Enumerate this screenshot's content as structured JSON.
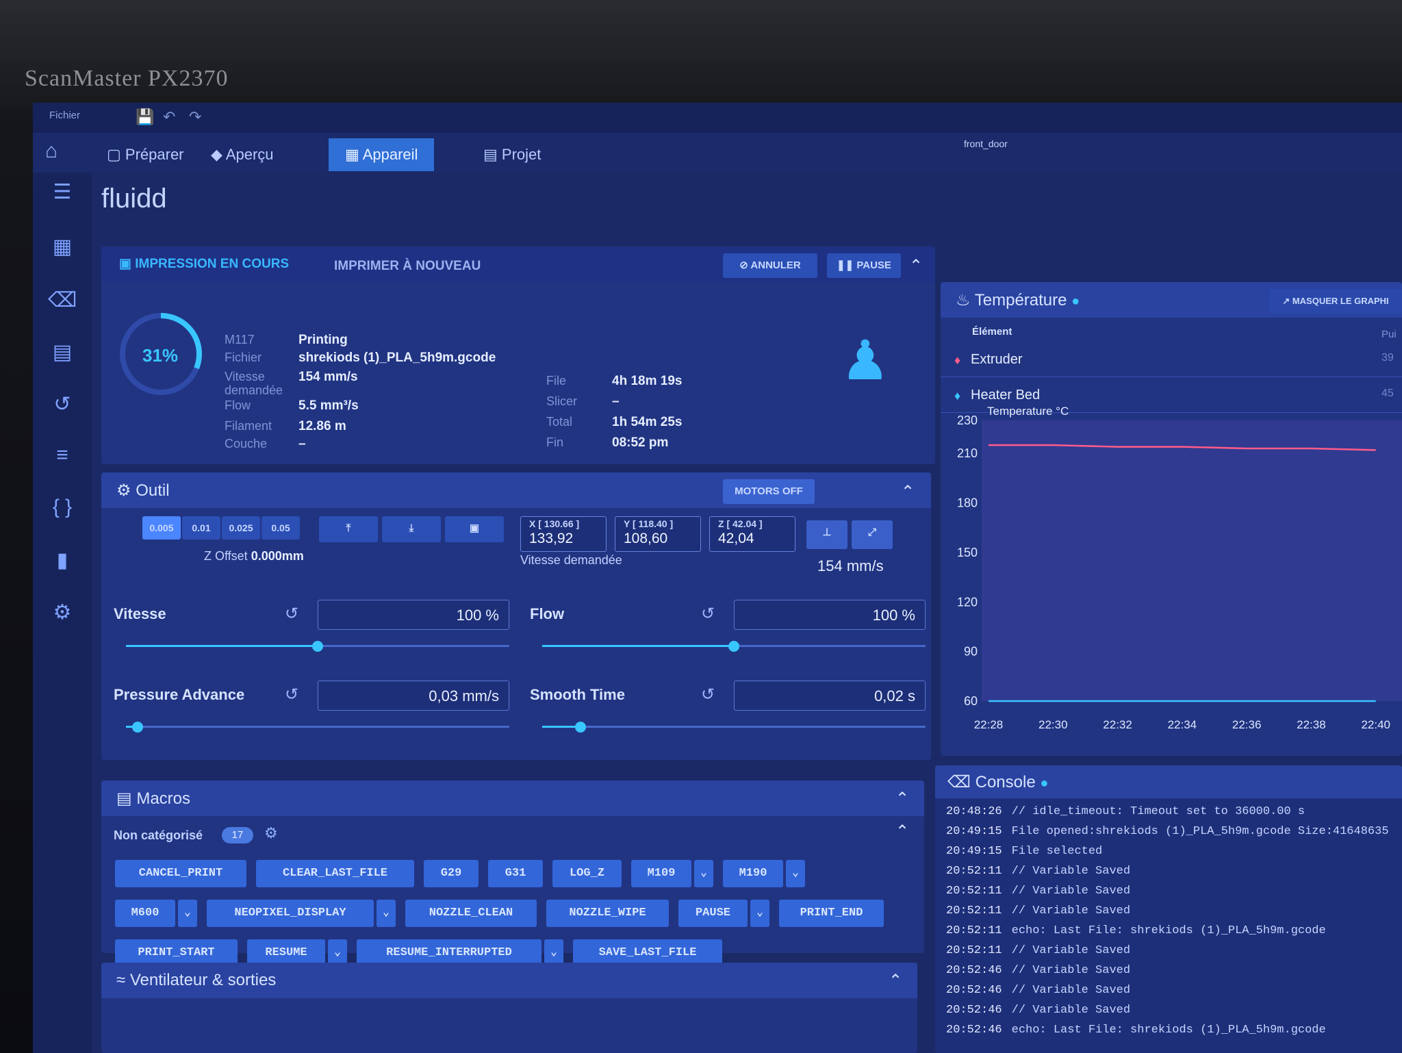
{
  "monitor": {
    "label": "ScanMaster PX2370"
  },
  "app": {
    "brand": "fluidd",
    "menu_label": "Fichier",
    "device_name": "front_door"
  },
  "nav": {
    "tabs": [
      {
        "label": "Préparer"
      },
      {
        "label": "Aperçu"
      },
      {
        "label": "Appareil"
      },
      {
        "label": "Projet"
      }
    ]
  },
  "job": {
    "tab_active": "IMPRESSION EN COURS",
    "tab_reprint": "IMPRIMER À NOUVEAU",
    "cancel_label": "ANNULER",
    "pause_label": "PAUSE",
    "progress_pct": 31,
    "progress_text": "31%",
    "fields": [
      {
        "label": "M117",
        "value": "Printing"
      },
      {
        "label": "Fichier",
        "value": "shrekiods (1)_PLA_5h9m.gcode"
      },
      {
        "label": "Vitesse demandée",
        "value": "154 mm/s"
      },
      {
        "label": "Flow",
        "value": "5.5 mm³/s"
      },
      {
        "label": "Filament",
        "value": "12.86 m"
      },
      {
        "label": "Couche",
        "value": "–"
      }
    ],
    "times": [
      {
        "label": "File",
        "value": "4h 18m 19s"
      },
      {
        "label": "Slicer",
        "value": "–"
      },
      {
        "label": "Total",
        "value": "1h 54m 25s"
      },
      {
        "label": "Fin",
        "value": "08:52 pm"
      }
    ]
  },
  "tool": {
    "title": "Outil",
    "motors_off": "MOTORS OFF",
    "steps": [
      "0.005",
      "0.01",
      "0.025",
      "0.05"
    ],
    "z_offset_label": "Z Offset",
    "z_offset_value": "0.000mm",
    "axes": [
      {
        "label": "X [ 130.66 ]",
        "value": "133,92"
      },
      {
        "label": "Y [ 118.40 ]",
        "value": "108,60"
      },
      {
        "label": "Z [ 42.04 ]",
        "value": "42,04"
      }
    ],
    "speed_caption": "Vitesse demandée",
    "speed_value": "154 mm/s",
    "controls": [
      {
        "label": "Vitesse",
        "value": "100 %",
        "pos": 0.5
      },
      {
        "label": "Flow",
        "value": "100 %",
        "pos": 0.5
      },
      {
        "label": "Pressure Advance",
        "value": "0,03 mm/s",
        "pos": 0.03
      },
      {
        "label": "Smooth Time",
        "value": "0,02 s",
        "pos": 0.1
      }
    ]
  },
  "macros": {
    "title": "Macros",
    "group": "Non catégorisé",
    "count": "17",
    "items": [
      "CANCEL_PRINT",
      "CLEAR_LAST_FILE",
      "G29",
      "G31",
      "LOG_Z",
      "M109",
      "M190",
      "M600",
      "NEOPIXEL_DISPLAY",
      "NOZZLE_CLEAN",
      "NOZZLE_WIPE",
      "PAUSE",
      "PRINT_END",
      "PRINT_START",
      "RESUME",
      "RESUME_INTERRUPTED",
      "SAVE_LAST_FILE"
    ]
  },
  "fans": {
    "title": "Ventilateur & sorties"
  },
  "temperature": {
    "title": "Température",
    "hide_graph": "MASQUER LE GRAPHI",
    "col_element": "Élément",
    "col_power": "Pui",
    "rows": [
      {
        "name": "Extruder",
        "power": "39",
        "color": "#ff5c8a"
      },
      {
        "name": "Heater Bed",
        "power": "45",
        "color": "#39c6ff"
      }
    ]
  },
  "chart_data": {
    "type": "line",
    "title": "Temperature °C",
    "yticks": [
      230,
      210,
      180,
      150,
      120,
      90,
      60
    ],
    "ylim": [
      60,
      230
    ],
    "xticks": [
      "22:28",
      "22:30",
      "22:32",
      "22:34",
      "22:36",
      "22:38",
      "22:40"
    ],
    "series": [
      {
        "name": "Extruder",
        "color": "#ff5c8a",
        "values": [
          215,
          215,
          214,
          214,
          213,
          213,
          212
        ]
      },
      {
        "name": "Heater Bed",
        "color": "#39c6ff",
        "values": [
          60,
          60,
          60,
          60,
          60,
          60,
          60
        ]
      }
    ]
  },
  "console": {
    "title": "Console",
    "lines": [
      {
        "time": "20:48:26",
        "text": "// idle_timeout: Timeout set to 36000.00 s"
      },
      {
        "time": "20:49:15",
        "text": "File opened:shrekiods (1)_PLA_5h9m.gcode Size:41648635"
      },
      {
        "time": "20:49:15",
        "text": "File selected"
      },
      {
        "time": "20:52:11",
        "text": "// Variable Saved"
      },
      {
        "time": "20:52:11",
        "text": "// Variable Saved"
      },
      {
        "time": "20:52:11",
        "text": "// Variable Saved"
      },
      {
        "time": "20:52:11",
        "text": "echo: Last File: shrekiods (1)_PLA_5h9m.gcode"
      },
      {
        "time": "20:52:11",
        "text": "// Variable Saved"
      },
      {
        "time": "20:52:46",
        "text": "// Variable Saved"
      },
      {
        "time": "20:52:46",
        "text": "// Variable Saved"
      },
      {
        "time": "20:52:46",
        "text": "// Variable Saved"
      },
      {
        "time": "20:52:46",
        "text": "echo: Last File: shrekiods (1)_PLA_5h9m.gcode"
      }
    ]
  }
}
